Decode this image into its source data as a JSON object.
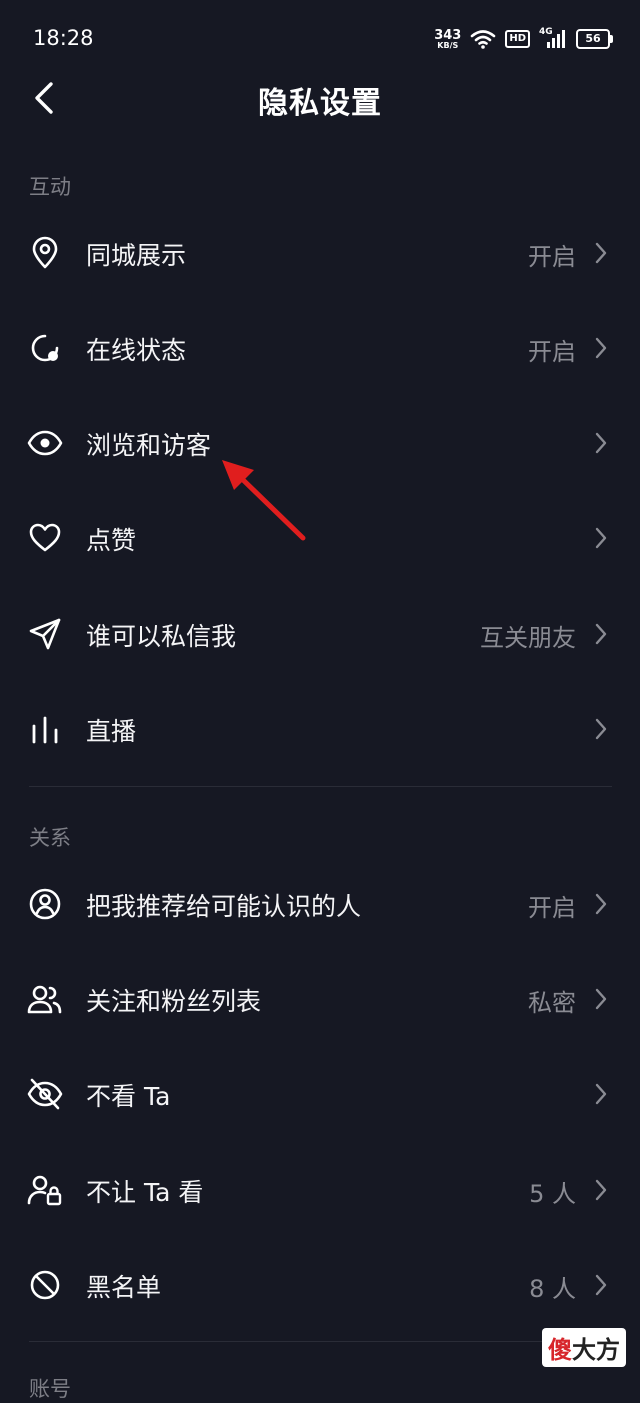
{
  "status_bar": {
    "time": "18:28",
    "net_speed_value": "343",
    "net_speed_unit": "KB/S",
    "hd_badge": "HD",
    "network_type": "4G",
    "battery": "56"
  },
  "header": {
    "title": "隐私设置"
  },
  "sections": [
    {
      "title": "互动",
      "items": [
        {
          "label": "同城展示",
          "value": "开启",
          "icon": "location-pin-icon"
        },
        {
          "label": "在线状态",
          "value": "开启",
          "icon": "online-status-icon"
        },
        {
          "label": "浏览和访客",
          "value": "",
          "icon": "eye-icon"
        },
        {
          "label": "点赞",
          "value": "",
          "icon": "heart-icon"
        },
        {
          "label": "谁可以私信我",
          "value": "互关朋友",
          "icon": "paper-plane-icon"
        },
        {
          "label": "直播",
          "value": "",
          "icon": "live-bars-icon"
        }
      ]
    },
    {
      "title": "关系",
      "items": [
        {
          "label": "把我推荐给可能认识的人",
          "value": "开启",
          "icon": "user-circle-icon"
        },
        {
          "label": "关注和粉丝列表",
          "value": "私密",
          "icon": "users-icon"
        },
        {
          "label": "不看 Ta",
          "value": "",
          "icon": "eye-off-icon"
        },
        {
          "label": "不让 Ta 看",
          "value": "5 人",
          "icon": "user-lock-icon"
        },
        {
          "label": "黑名单",
          "value": "8 人",
          "icon": "block-icon"
        }
      ]
    },
    {
      "title": "账号",
      "items": []
    }
  ],
  "watermark": {
    "part1": "傻",
    "part2": "大方"
  },
  "colors": {
    "background": "#161823",
    "text_primary": "#f4f4f6",
    "text_secondary": "#8a8b93",
    "annotation_arrow": "#e01e1e"
  }
}
